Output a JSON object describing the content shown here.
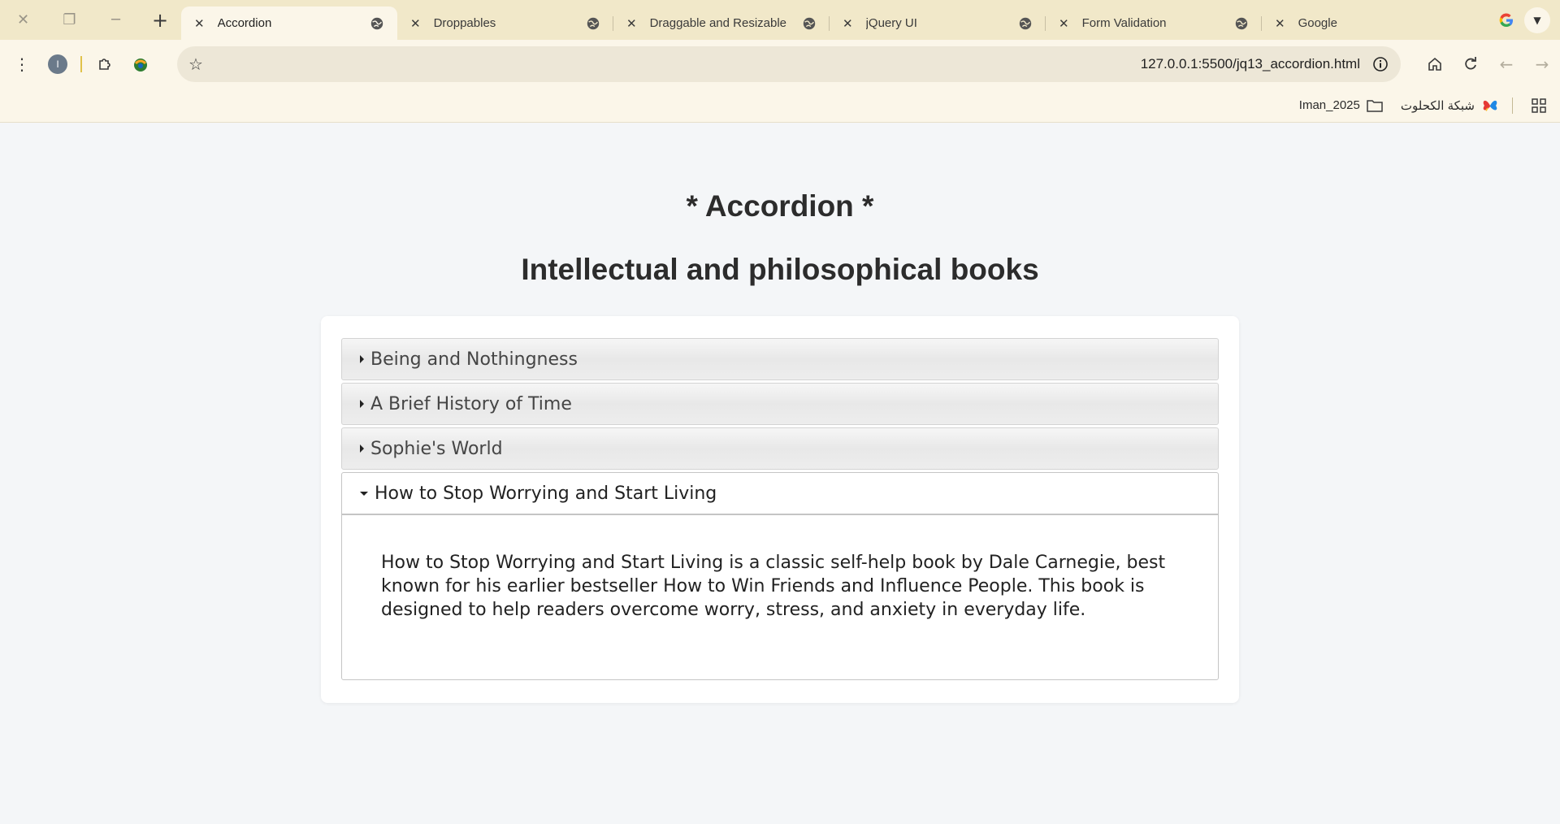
{
  "browser": {
    "tabs": [
      {
        "title": "Accordion",
        "active": true
      },
      {
        "title": "Droppables",
        "active": false
      },
      {
        "title": "Draggable and Resizable",
        "active": false
      },
      {
        "title": "jQuery UI",
        "active": false
      },
      {
        "title": "Form Validation",
        "active": false
      },
      {
        "title": "Google",
        "active": false
      }
    ],
    "profile_initial": "I",
    "url": "127.0.0.1:5500/jq13_accordion.html",
    "bookmarks": [
      {
        "label": "Iman_2025",
        "icon": "folder-icon"
      },
      {
        "label": "شبكة الكحلوت",
        "icon": "butterfly-icon"
      }
    ]
  },
  "page": {
    "title": "* Accordion *",
    "subtitle": "Intellectual and philosophical books",
    "accordion": [
      {
        "header": "Being and Nothingness",
        "open": false
      },
      {
        "header": "A Brief History of Time",
        "open": false
      },
      {
        "header": "Sophie's World",
        "open": false
      },
      {
        "header": "How to Stop Worrying and Start Living",
        "open": true,
        "content": "How to Stop Worrying and Start Living is a classic self-help book by Dale Carnegie, best known for his earlier bestseller How to Win Friends and Influence People. This book is designed to help readers overcome worry, stress, and anxiety in everyday life."
      }
    ]
  },
  "colors": {
    "tabstrip": "#f1e8c9",
    "toolbar": "#fbf6e9",
    "page_bg": "#f4f6f8"
  }
}
